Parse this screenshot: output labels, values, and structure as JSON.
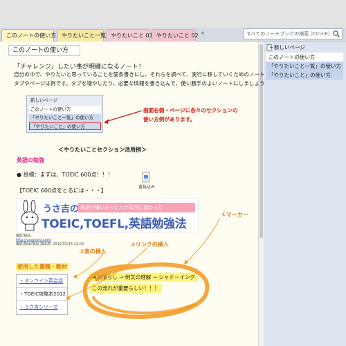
{
  "tabs": [
    {
      "label": "このノートの使い方"
    },
    {
      "label": "やりたいこと一覧"
    },
    {
      "label": "やりたいこと 01"
    },
    {
      "label": "やりたいこと 02"
    }
  ],
  "tab_add": "*",
  "search": {
    "placeholder": "すべてのノートブックの検索 (Ctrl+E)"
  },
  "page": {
    "title": "このノートの使い方",
    "line1": "「チャレンジ」したい事が明確になるノート！",
    "line2": "自分の中で、やりたいと思っていることを箇条書きにし、それらを調べて、実行に移していくためのノートです。",
    "line3": "タブやページは例です。タブを増やしたり、必要な情報を書き込んで、使い勝手のよいノートにしましょう。",
    "mini_list": [
      "新しいページ",
      "このノートの使い方",
      "「やりたいこと一覧」の使い方",
      "「やりたいこと」の使い方"
    ],
    "red_note_1": "画面右側・ページに各々のセクションの",
    "red_note_2": "使い方例があります。",
    "section_title": "＜やりたいことセクション活用例＞",
    "english_head": "英語の勉強",
    "goal": "●  目標：まずは、TOEIC 600点！！！",
    "toeic_line": "【TOEIC 600点をとるには・・・】",
    "clip_label": "書抜込み",
    "banner": {
      "title": "うさ吉の",
      "tagline": "英語が嫌いだった人が本当に変わった",
      "main": "TOEIC,TOEFL,英語勉強法"
    },
    "source_1": "撮影/抽出",
    "source_link": "http://usayoshi.com/",
    "source_2": "撮影/抽出/抽出 抽出済: 2012/03/14 12:03",
    "label_marker": "①マーカー",
    "label_table": "②表の挿入",
    "label_link": "③リンクの挿入",
    "books_head": "使用した書籍・教材",
    "books": [
      "・オンライン英会話",
      "・TOEIC攻略本2012",
      "・うさ吉シリーズ"
    ],
    "highlight_1": "★耳慣らし → 例文の理解 → シャドーイング",
    "highlight_2": "この流れが重要らしい！！！"
  },
  "sidebar": {
    "new_page": "新しいページ",
    "items": [
      "このノートの使い方",
      "「やりたいこと一覧」の使い方",
      "「やりたいこと」の使い方"
    ]
  },
  "colors": {
    "accent_red": "#d31b1b",
    "marker_orange": "#f29720",
    "highlight_yellow": "#fff47a",
    "link_blue": "#2a5cc2"
  }
}
